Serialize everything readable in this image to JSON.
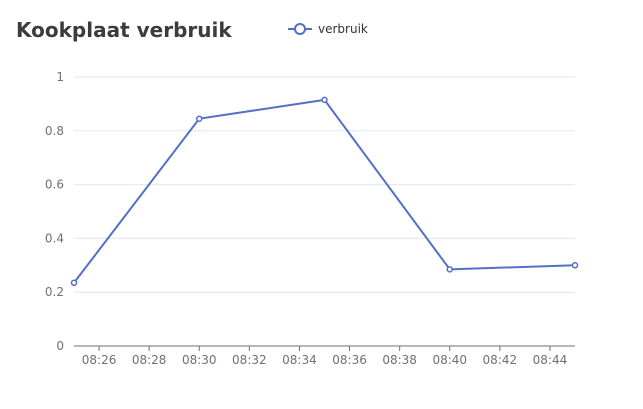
{
  "chart_data": {
    "type": "line",
    "title": "Kookplaat verbruik",
    "x_ticks": [
      "08:26",
      "08:28",
      "08:30",
      "08:32",
      "08:34",
      "08:36",
      "08:38",
      "08:40",
      "08:42",
      "08:44"
    ],
    "y_ticks": [
      "0",
      "0.2",
      "0.4",
      "0.6",
      "0.8",
      "1"
    ],
    "ylim": [
      0,
      1
    ],
    "xlim": [
      "08:25",
      "08:45"
    ],
    "grid": true,
    "legend_position": "top-center",
    "series": [
      {
        "name": "verbruik",
        "color": "#5470c6",
        "points": [
          {
            "x": "08:25",
            "y": 0.235
          },
          {
            "x": "08:30",
            "y": 0.845
          },
          {
            "x": "08:35",
            "y": 0.915
          },
          {
            "x": "08:40",
            "y": 0.285
          },
          {
            "x": "08:45",
            "y": 0.3
          }
        ]
      }
    ]
  }
}
